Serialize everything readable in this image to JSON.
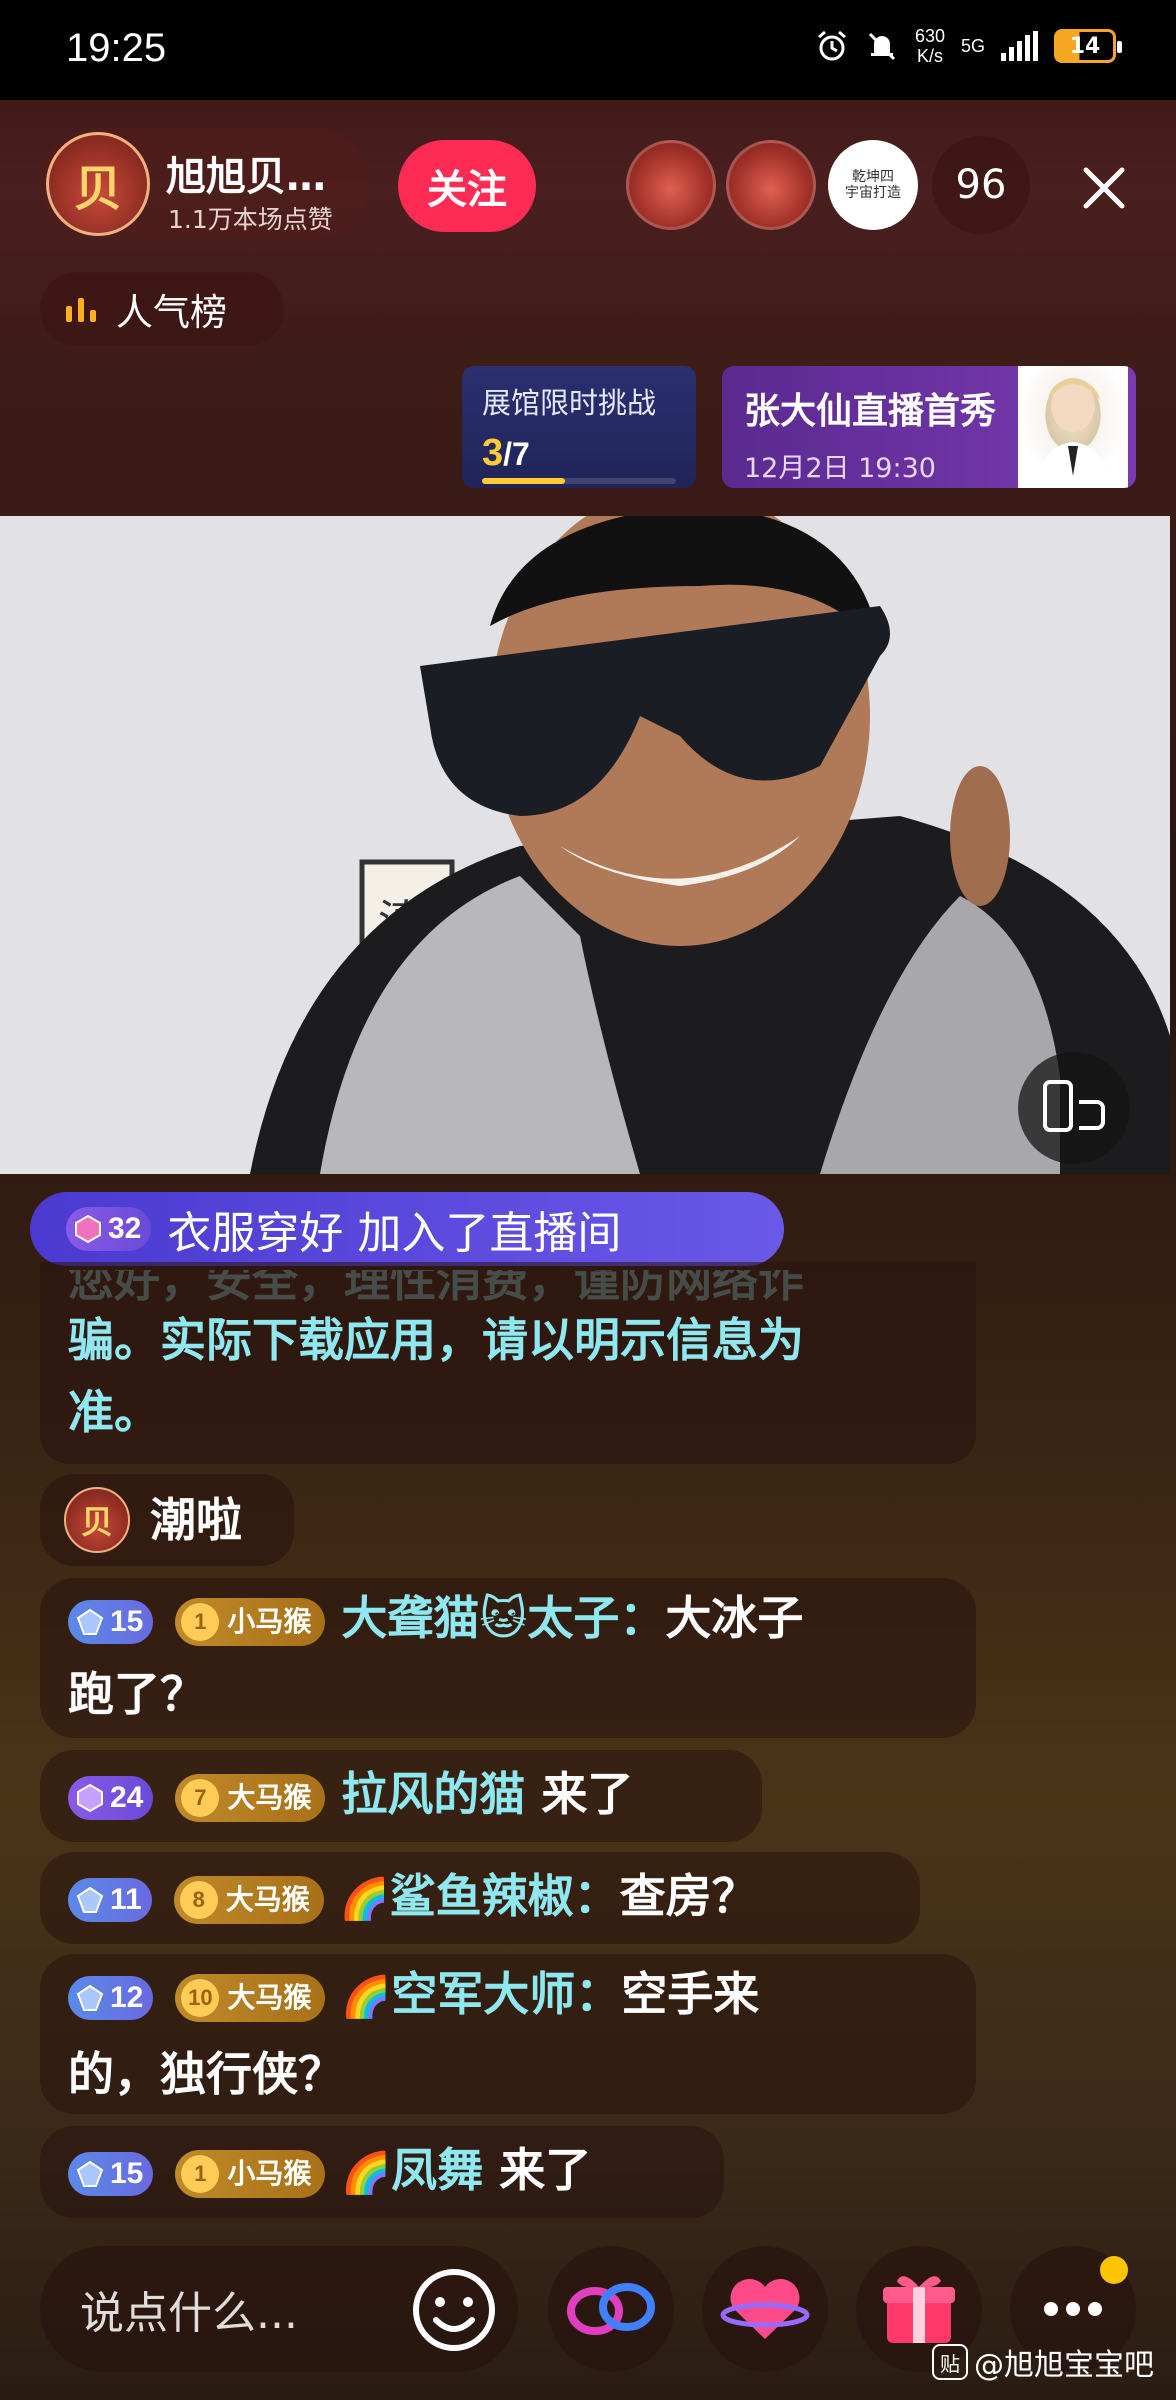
{
  "status_bar": {
    "time": "19:25",
    "network_speed_value": "630",
    "network_speed_unit": "K/s",
    "network_type": "5G",
    "battery": "14"
  },
  "host": {
    "avatar_char": "贝",
    "name": "旭旭贝…",
    "likes": "1.1万本场点赞",
    "follow_label": "关注"
  },
  "viewers": {
    "count": "96",
    "avatar3_text": "乾坤四\n宇宙打造"
  },
  "ranking": {
    "label": "人气榜"
  },
  "challenge": {
    "title": "展馆限时挑战",
    "current": "3",
    "total": "/7",
    "progress": 0.43
  },
  "promo": {
    "title": "张大仙直播首秀",
    "time": "12月2日  19:30"
  },
  "video_scene": {
    "poster_char": "滇"
  },
  "join_banner": {
    "level": "32",
    "text": "衣服穿好 加入了直播间"
  },
  "system_message": {
    "faded_line": "您好，安全，理性消费，谨防网络诈",
    "line1": "骗。实际下载应用，请以明示信息为",
    "line2": "准。"
  },
  "chat": [
    {
      "avatar_char": "贝",
      "text": "潮啦"
    },
    {
      "level": "15",
      "fan_level": "1",
      "fan_name": "小马猴",
      "user": "大聋猫🐱太子：",
      "text": "大冰子",
      "text2": "跑了？"
    },
    {
      "level": "24",
      "fan_level": "7",
      "fan_name": "大马猴",
      "user": "拉风的猫",
      "text": " 来了"
    },
    {
      "level": "11",
      "fan_level": "8",
      "fan_name": "大马猴",
      "prefix": "🌈",
      "user": "鲨鱼辣椒：",
      "text": "查房？"
    },
    {
      "level": "12",
      "fan_level": "10",
      "fan_name": "大马猴",
      "prefix": "🌈",
      "user": "空军大师：",
      "text": "空手来",
      "text2": "的，独行侠？"
    },
    {
      "level": "15",
      "fan_level": "1",
      "fan_name": "小马猴",
      "prefix": "🌈",
      "user": "凤舞",
      "text": " 来了"
    }
  ],
  "bottom_bar": {
    "input_placeholder": "说点什么...",
    "icons": [
      "emoji-icon",
      "link-mic-icon",
      "heart-planet-icon",
      "gift-icon",
      "more-icon"
    ]
  },
  "watermark": {
    "icon_char": "贴",
    "text": "@旭旭宝宝吧"
  },
  "colors": {
    "follow": "#fe2c55",
    "username": "#8fe8f0",
    "challenge_accent": "#ffcc33",
    "join_banner": "#5a48e0",
    "notification_dot": "#ffc400"
  }
}
